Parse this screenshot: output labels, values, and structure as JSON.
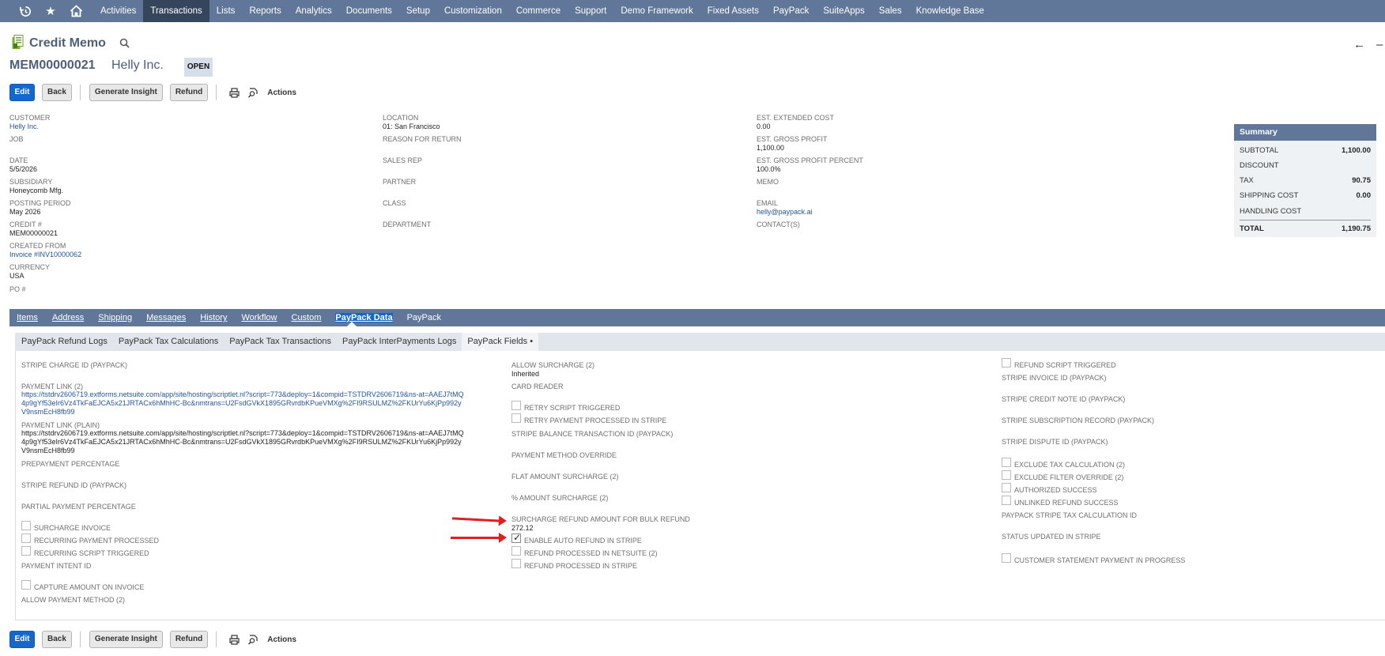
{
  "nav": {
    "items": [
      "Activities",
      "Transactions",
      "Lists",
      "Reports",
      "Analytics",
      "Documents",
      "Setup",
      "Customization",
      "Commerce",
      "Support",
      "Demo Framework",
      "Fixed Assets",
      "PayPack",
      "SuiteApps",
      "Sales",
      "Knowledge Base"
    ],
    "active": "Transactions"
  },
  "page": {
    "title": "Credit Memo",
    "record_number": "MEM00000021",
    "customer_name": "Helly Inc.",
    "status": "OPEN"
  },
  "buttons": {
    "edit": "Edit",
    "back": "Back",
    "generate_insight": "Generate Insight",
    "refund": "Refund",
    "actions": "Actions"
  },
  "primary": {
    "customer_label": "CUSTOMER",
    "customer_value": "Helly Inc.",
    "job_label": "JOB",
    "date_label": "DATE",
    "date_value": "5/5/2026",
    "subsidiary_label": "SUBSIDIARY",
    "subsidiary_value": "Honeycomb Mfg.",
    "posting_label": "POSTING PERIOD",
    "posting_value": "May 2026",
    "credit_label": "CREDIT #",
    "credit_value": "MEM00000021",
    "created_label": "CREATED FROM",
    "created_value": "Invoice #INV10000062",
    "currency_label": "CURRENCY",
    "currency_value": "USA",
    "po_label": "PO #",
    "location_label": "LOCATION",
    "location_value": "01: San Francisco",
    "reason_label": "REASON FOR RETURN",
    "salesrep_label": "SALES REP",
    "partner_label": "PARTNER",
    "class_label": "CLASS",
    "department_label": "DEPARTMENT",
    "extcost_label": "EST. EXTENDED COST",
    "extcost_value": "0.00",
    "grossprofit_label": "EST. GROSS PROFIT",
    "grossprofit_value": "1,100.00",
    "gppercent_label": "EST. GROSS PROFIT PERCENT",
    "gppercent_value": "100.0%",
    "memo_label": "MEMO",
    "email_label": "EMAIL",
    "email_value": "helly@paypack.ai",
    "contacts_label": "CONTACT(S)"
  },
  "summary": {
    "title": "Summary",
    "subtotal_label": "SUBTOTAL",
    "subtotal_value": "1,100.00",
    "discount_label": "DISCOUNT",
    "tax_label": "TAX",
    "tax_value": "90.75",
    "shipping_label": "SHIPPING COST",
    "shipping_value": "0.00",
    "handling_label": "HANDLING COST",
    "total_label": "TOTAL",
    "total_value": "1,190.75"
  },
  "tabs": [
    "Items",
    "Address",
    "Shipping",
    "Messages",
    "History",
    "Workflow",
    "Custom",
    "PayPack Data",
    "PayPack"
  ],
  "active_tab": "PayPack Data",
  "subtabs": [
    "PayPack Refund Logs",
    "PayPack Tax Calculations",
    "PayPack Tax Transactions",
    "PayPack InterPayments Logs",
    "PayPack Fields •"
  ],
  "active_subtab": "PayPack Fields •",
  "fields": {
    "col1": {
      "stripe_charge_id": "STRIPE CHARGE ID (PAYPACK)",
      "payment_link_label": "PAYMENT LINK (2)",
      "payment_link_value": "https://tstdrv2606719.extforms.netsuite.com/app/site/hosting/scriptlet.nl?script=773&deploy=1&compid=TSTDRV2606719&ns-at=AAEJ7tMQ4p9gYf53eIr6Vz4TkFaEJCA5x21JRTACx6hMhHC-Bc&nmtrans=U2FsdGVkX1895GRvrdbKPueVMXg%2FI9RSULMZ%2FKUrYu6KjPp992yV9nsmEcH8fb99",
      "payment_link_plain_label": "PAYMENT LINK (PLAIN)",
      "payment_link_plain_value": "https://tstdrv2606719.extforms.netsuite.com/app/site/hosting/scriptlet.nl?script=773&deploy=1&compid=TSTDRV2606719&ns-at=AAEJ7tMQ4p9gYf53eIr6Vz4TkFaEJCA5x21JRTACx6hMhHC-Bc&nmtrans=U2FsdGVkX1895GRvrdbKPueVMXg%2FI9RSULMZ%2FKUrYu6KjPp992yV9nsmEcH8fb99",
      "prepayment": "PREPAYMENT PERCENTAGE",
      "stripe_refund_id": "STRIPE REFUND ID (PAYPACK)",
      "partial_payment": "PARTIAL PAYMENT PERCENTAGE",
      "surcharge_invoice": "SURCHARGE INVOICE",
      "recurring_processed": "RECURRING PAYMENT PROCESSED",
      "recurring_triggered": "RECURRING SCRIPT TRIGGERED",
      "payment_intent": "PAYMENT INTENT ID",
      "capture_amount": "CAPTURE AMOUNT ON INVOICE",
      "allow_payment_method": "ALLOW PAYMENT METHOD (2)"
    },
    "col2": {
      "allow_surcharge_label": "ALLOW SURCHARGE (2)",
      "allow_surcharge_value": "Inherited",
      "card_reader": "CARD READER",
      "retry_triggered": "RETRY SCRIPT TRIGGERED",
      "retry_processed": "RETRY PAYMENT PROCESSED IN STRIPE",
      "balance_txn": "STRIPE BALANCE TRANSACTION ID (PAYPACK)",
      "pm_override": "PAYMENT METHOD OVERRIDE",
      "flat_surcharge": "FLAT AMOUNT SURCHARGE (2)",
      "pct_surcharge": "% AMOUNT SURCHARGE (2)",
      "bulk_refund_label": "SURCHARGE REFUND AMOUNT FOR BULK REFUND",
      "bulk_refund_value": "272.12",
      "enable_auto_refund": "ENABLE AUTO REFUND IN STRIPE",
      "refund_netsuite": "REFUND PROCESSED IN NETSUITE (2)",
      "refund_stripe": "REFUND PROCESSED IN STRIPE"
    },
    "col3": {
      "refund_triggered": "REFUND SCRIPT TRIGGERED",
      "invoice_id": "STRIPE INVOICE ID (PAYPACK)",
      "credit_note_id": "STRIPE CREDIT NOTE ID (PAYPACK)",
      "subscription_record": "STRIPE SUBSCRIPTION RECORD (PAYPACK)",
      "dispute_id": "STRIPE DISPUTE ID (PAYPACK)",
      "exclude_tax": "EXCLUDE TAX CALCULATION (2)",
      "exclude_filter": "EXCLUDE FILTER OVERRIDE (2)",
      "authorized": "AUTHORIZED SUCCESS",
      "unlinked_refund": "UNLINKED REFUND SUCCESS",
      "tax_calc_id": "PAYPACK STRIPE TAX CALCULATION ID",
      "status_updated": "STATUS UPDATED IN STRIPE",
      "customer_statement": "CUSTOMER STATEMENT PAYMENT IN PROGRESS"
    }
  },
  "colors": {
    "nav_bg": "#607799",
    "nav_active": "#35465c",
    "primary_button": "#1467cc",
    "link": "#255599",
    "annotation_arrow": "#e02020"
  },
  "icons": [
    "history-icon",
    "star-icon",
    "home-icon",
    "record-icon",
    "search-icon",
    "back-arrow-icon",
    "print-icon",
    "search-refresh-icon",
    "checkmark-icon"
  ]
}
